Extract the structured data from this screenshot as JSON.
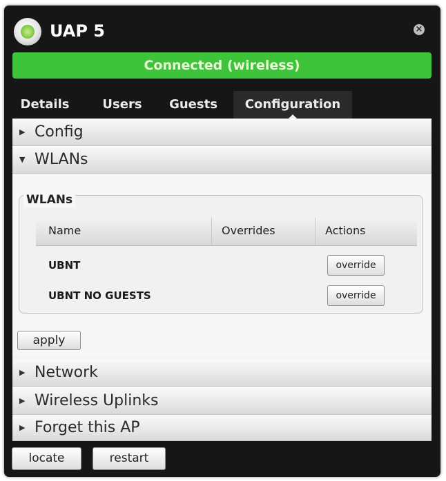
{
  "window": {
    "title": "UAP 5",
    "status": "Connected (wireless)",
    "status_color": "#3ec43a"
  },
  "tabs": [
    {
      "label": "Details",
      "active": false
    },
    {
      "label": "Users",
      "active": false
    },
    {
      "label": "Guests",
      "active": false
    },
    {
      "label": "Configuration",
      "active": true
    }
  ],
  "sections": {
    "config": {
      "label": "Config",
      "expanded": false
    },
    "wlans": {
      "label": "WLANs",
      "expanded": true
    },
    "network": {
      "label": "Network",
      "expanded": false
    },
    "wireless_uplinks": {
      "label": "Wireless Uplinks",
      "expanded": false
    },
    "forget": {
      "label": "Forget this AP",
      "expanded": false
    }
  },
  "wlan_group": {
    "legend": "WLANs",
    "columns": [
      "Name",
      "Overrides",
      "Actions"
    ],
    "rows": [
      {
        "name": "UBNT",
        "overrides": "",
        "action_label": "override"
      },
      {
        "name": "UBNT NO GUESTS",
        "overrides": "",
        "action_label": "override"
      }
    ]
  },
  "buttons": {
    "apply": "apply",
    "locate": "locate",
    "restart": "restart"
  },
  "icons": {
    "app": "access-point-icon",
    "close": "close-icon",
    "collapsed": "caret-right-icon",
    "expanded": "caret-down-icon"
  }
}
